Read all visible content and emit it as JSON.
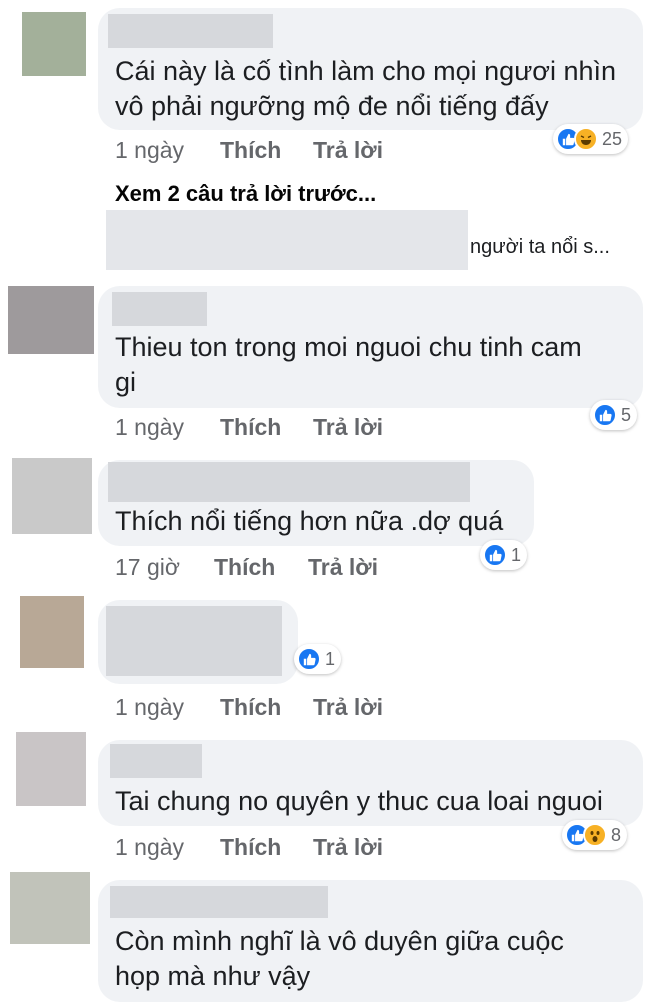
{
  "actions": {
    "like": "Thích",
    "reply": "Trả lời"
  },
  "comments": [
    {
      "text_lines": [
        "Cái này là cố tình làm cho mọi ngươi nhìn",
        "vô phải ngưỡng mộ đe nổi tiếng đấy"
      ],
      "time": "1 ngày",
      "reactions": {
        "types": [
          "like",
          "haha"
        ],
        "count": "25"
      },
      "avatar_color": "#a3b09a"
    },
    {
      "text_lines": [
        "Thieu ton trong moi nguoi chu tinh cam",
        "gi"
      ],
      "time": "1 ngày",
      "reactions": {
        "types": [
          "like"
        ],
        "count": "5"
      },
      "avatar_color": "#9e9a9c"
    },
    {
      "text_lines": [
        "Thích nổi tiếng hơn nữa  .dợ quá"
      ],
      "time": "17 giờ",
      "reactions": {
        "types": [
          "like"
        ],
        "count": "1"
      },
      "avatar_color": "#c9c9c9"
    },
    {
      "text_lines": [],
      "time": "1 ngày",
      "reactions": {
        "types": [
          "like"
        ],
        "count": "1"
      },
      "avatar_color": "#b8a896"
    },
    {
      "text_lines": [
        "Tai chung no quyên y thuc cua loai nguoi"
      ],
      "time": "1 ngày",
      "reactions": {
        "types": [
          "like",
          "wow"
        ],
        "count": "8"
      },
      "avatar_color": "#c9c5c6"
    },
    {
      "text_lines": [
        "Còn mình  nghĩ  là vô duyên giữa cuộc",
        "họp mà như  vậy"
      ],
      "time": "",
      "reactions": null,
      "avatar_color": "#c1c3ba"
    }
  ],
  "previous_replies": {
    "label": "Xem 2 câu trả lời trước...",
    "preview_text": "người ta nổi s..."
  }
}
